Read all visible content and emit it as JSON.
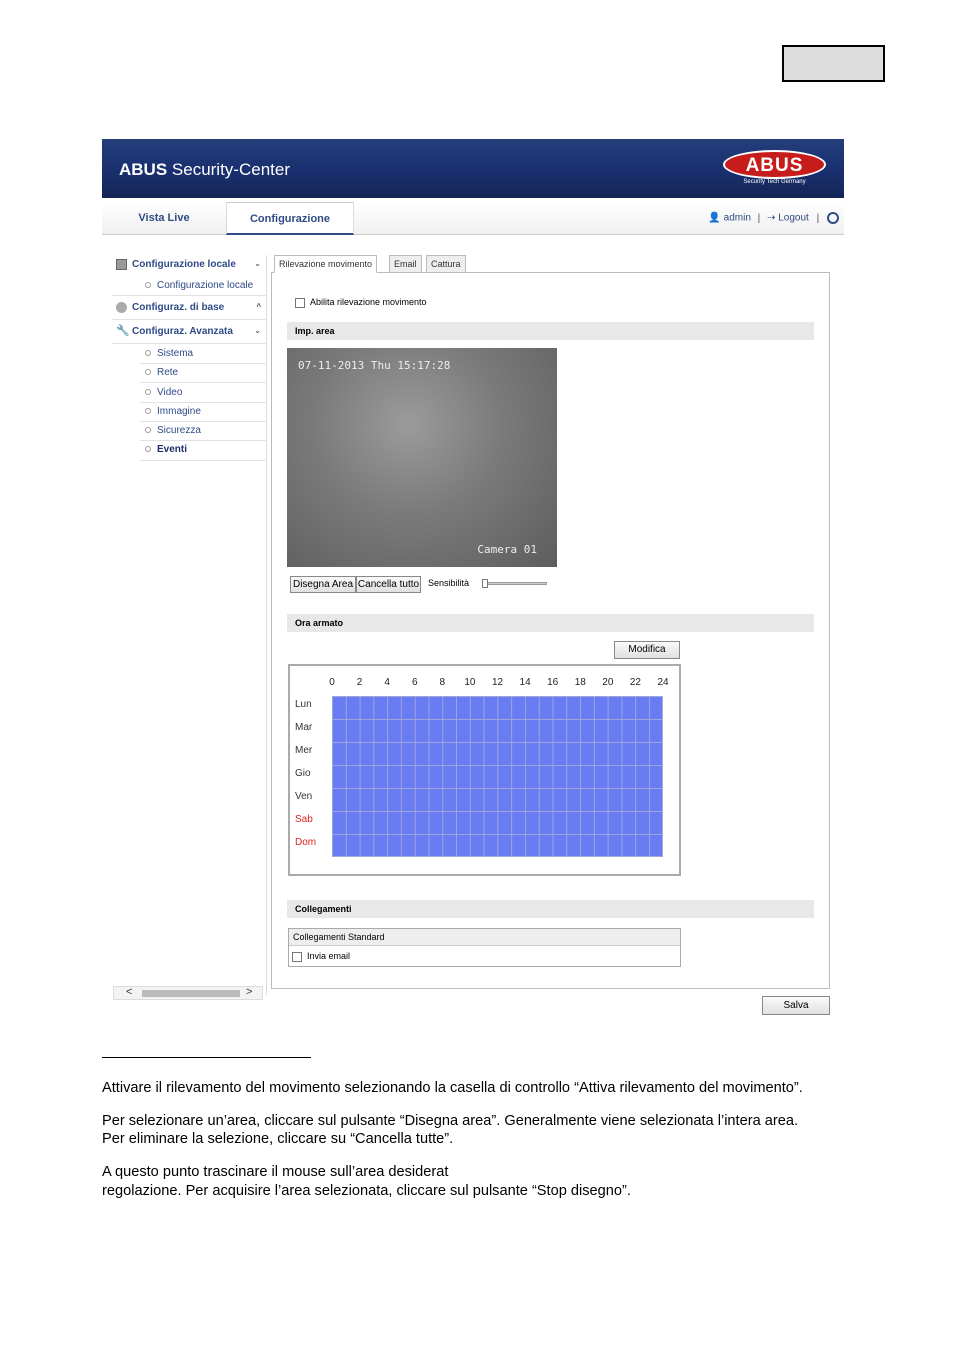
{
  "app": {
    "title_bold": "ABUS",
    "title_rest": " Security-Center",
    "logo_text": "ABUS",
    "logo_subtitle": "Security Tech Germany"
  },
  "nav": {
    "tabs": [
      "Vista Live",
      "Configurazione"
    ],
    "user": "admin",
    "separator": "|",
    "logout": "Logout"
  },
  "sidebar": {
    "sections": [
      {
        "label": "Configurazione locale",
        "chevron": "⌄"
      },
      {
        "label": "Configuraz. di base",
        "chevron": "^"
      },
      {
        "label": "Configuraz. Avanzata",
        "chevron": "⌄"
      }
    ],
    "local_sub": "Configurazione locale",
    "advanced_sub": [
      "Sistema",
      "Rete",
      "Video",
      "Immagine",
      "Sicurezza",
      "Eventi"
    ],
    "scroll_left": "<",
    "scroll_right": ">"
  },
  "tabs": [
    "Rilevazione movimento",
    "Email",
    "Cattura"
  ],
  "motion": {
    "enable_label": "Abilita rilevazione movimento",
    "area_header": "Imp. area",
    "timestamp": "07-11-2013 Thu 15:17:28",
    "camera_label": "Camera 01",
    "draw_area": "Disegna Area",
    "clear_all": "Cancella tutto",
    "sensitivity": "Sensibilità",
    "sensitivity_level": 0.0
  },
  "schedule": {
    "header": "Ora armato",
    "modify": "Modifica",
    "hours": [
      "0",
      "2",
      "4",
      "6",
      "8",
      "10",
      "12",
      "14",
      "16",
      "18",
      "20",
      "22",
      "24"
    ],
    "days": [
      "Lun",
      "Mar",
      "Mer",
      "Gio",
      "Ven",
      "Sab",
      "Dom"
    ],
    "armed_color": "#6a7cf2",
    "weekend_color": "#e02020"
  },
  "links": {
    "header": "Collegamenti",
    "standard": "Collegamenti Standard",
    "send_email": "Invia email"
  },
  "save_label": "Salva",
  "doc_text": {
    "p1": "Attivare il rilevamento del movimento selezionando la casella di controllo “Attiva rilevamento del movimento”.",
    "p2": "Per selezionare un’area, cliccare sul pulsante “Disegna area”. Generalmente viene selezionata l’intera area.",
    "p3": "Per eliminare la selezione, cliccare su “Cancella tutte”.",
    "p4": "A questo punto trascinare il mouse sull’area desiderat",
    "p5": "regolazione. Per acquisire l’area selezionata, cliccare sul pulsante “Stop disegno”."
  }
}
